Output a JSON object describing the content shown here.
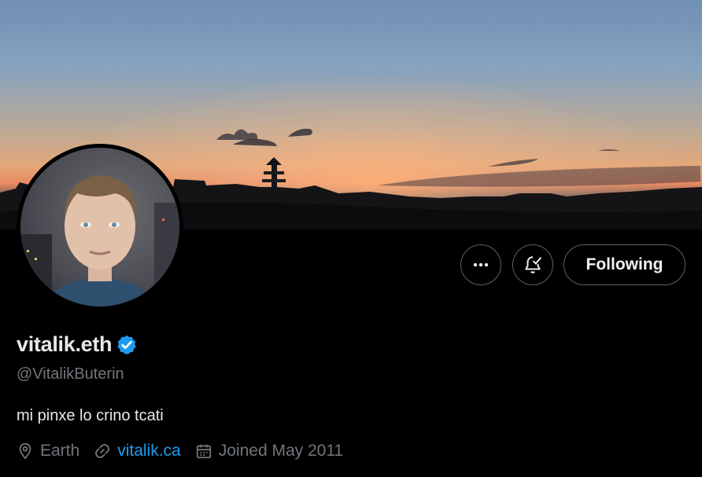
{
  "profile": {
    "display_name": "vitalik.eth",
    "handle": "@VitalikButerin",
    "bio": "mi pinxe lo crino tcati",
    "location": "Earth",
    "website": "vitalik.ca",
    "joined": "Joined May 2011",
    "verified": true
  },
  "actions": {
    "follow_label": "Following",
    "more_icon": "more-dots-icon",
    "notify_icon": "bell-check-icon"
  },
  "colors": {
    "background": "#000000",
    "accent": "#1d9bf0",
    "secondary_text": "#71767b",
    "border": "#536471"
  }
}
